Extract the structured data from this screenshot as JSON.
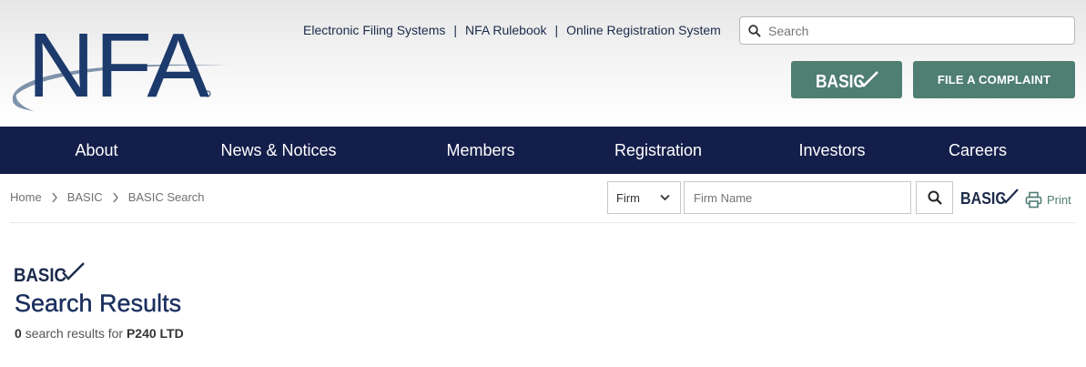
{
  "header": {
    "logo_text": "NFA",
    "links": [
      "Electronic Filing Systems",
      "NFA Rulebook",
      "Online Registration System"
    ],
    "separator": "|",
    "search_placeholder": "Search",
    "basic_button_label": "BASIC",
    "complaint_button_label": "FILE A COMPLAINT"
  },
  "nav": {
    "items": [
      "About",
      "News & Notices",
      "Members",
      "Registration",
      "Investors",
      "Careers"
    ]
  },
  "breadcrumb": {
    "items": [
      "Home",
      "BASIC",
      "BASIC Search"
    ]
  },
  "search_bar": {
    "type_selected": "Firm",
    "name_placeholder": "Firm Name",
    "basic_logo_label": "BASIC",
    "print_label": "Print"
  },
  "results": {
    "logo_label": "BASIC",
    "title": "Search Results",
    "count": "0",
    "middle_text": "search results for",
    "query": "P240 LTD"
  },
  "colors": {
    "navy": "#141e4a",
    "green": "#4f7e73",
    "title_blue": "#1b2f5e"
  },
  "icons": [
    "search-icon",
    "check-icon",
    "chevron-right-icon",
    "chevron-down-icon",
    "printer-icon"
  ]
}
